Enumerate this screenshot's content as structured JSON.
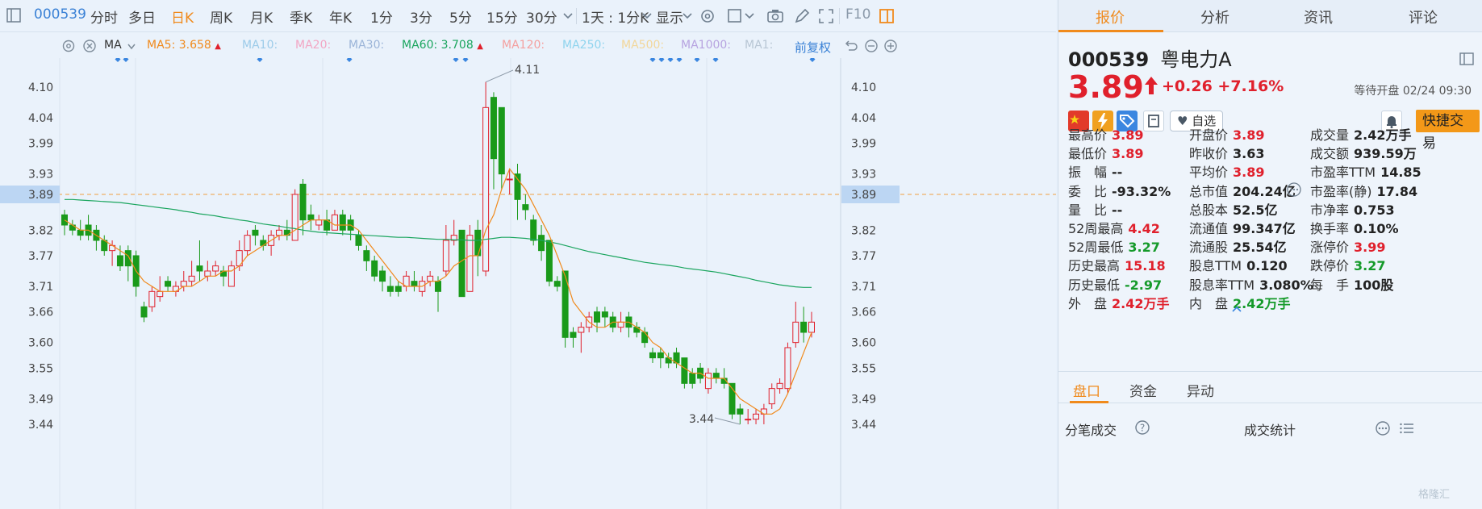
{
  "toolbar": {
    "stock_code": "000539",
    "periods": [
      "分时",
      "多日",
      "日K",
      "周K",
      "月K",
      "季K",
      "年K",
      "1分",
      "3分",
      "5分",
      "15分",
      "30分"
    ],
    "active_period": "日K",
    "interval_label": "1天 : 1分K",
    "display_label": "显示",
    "f10_label": "F10"
  },
  "ma_bar": {
    "type_label": "MA",
    "items": [
      {
        "label": "MA5:",
        "value": "3.658",
        "color": "#f08a1c",
        "arrow": true
      },
      {
        "label": "MA10:",
        "value": "",
        "color": "#9ccbe9",
        "arrow": false
      },
      {
        "label": "MA20:",
        "value": "",
        "color": "#f2a6c4",
        "arrow": false
      },
      {
        "label": "MA30:",
        "value": "",
        "color": "#9bb4d8",
        "arrow": false
      },
      {
        "label": "MA60:",
        "value": "3.708",
        "color": "#1aa55e",
        "arrow": true
      },
      {
        "label": "MA120:",
        "value": "",
        "color": "#f4a0a0",
        "arrow": false
      },
      {
        "label": "MA250:",
        "value": "",
        "color": "#8fd4ee",
        "arrow": false
      },
      {
        "label": "MA500:",
        "value": "",
        "color": "#f2d79b",
        "arrow": false
      },
      {
        "label": "MA1000:",
        "value": "",
        "color": "#b7a3e0",
        "arrow": false
      },
      {
        "label": "MA1:",
        "value": "",
        "color": "#b8c6d4",
        "arrow": false
      }
    ],
    "adjust_label": "前复权"
  },
  "chart_data": {
    "type": "candlestick",
    "y_ticks": [
      "4.10",
      "4.04",
      "3.99",
      "3.93",
      "3.89",
      "3.82",
      "3.77",
      "3.71",
      "3.66",
      "3.60",
      "3.55",
      "3.49",
      "3.44"
    ],
    "ylim": [
      3.405,
      4.16
    ],
    "current_price": 3.89,
    "max_label": "4.11",
    "min_label": "3.44",
    "up_color": "#e0202c",
    "down_color": "#1a9a1a",
    "candles": [
      [
        3.85,
        3.83,
        3.86,
        3.81
      ],
      [
        3.83,
        3.82,
        3.84,
        3.81
      ],
      [
        3.82,
        3.81,
        3.84,
        3.8
      ],
      [
        3.83,
        3.81,
        3.85,
        3.8
      ],
      [
        3.82,
        3.8,
        3.83,
        3.78
      ],
      [
        3.8,
        3.78,
        3.81,
        3.77
      ],
      [
        3.78,
        3.79,
        3.8,
        3.75
      ],
      [
        3.77,
        3.75,
        3.79,
        3.74
      ],
      [
        3.78,
        3.75,
        3.79,
        3.72
      ],
      [
        3.77,
        3.71,
        3.78,
        3.69
      ],
      [
        3.67,
        3.65,
        3.68,
        3.64
      ],
      [
        3.67,
        3.7,
        3.71,
        3.66
      ],
      [
        3.69,
        3.7,
        3.73,
        3.68
      ],
      [
        3.72,
        3.71,
        3.73,
        3.7
      ],
      [
        3.7,
        3.71,
        3.72,
        3.69
      ],
      [
        3.71,
        3.72,
        3.74,
        3.7
      ],
      [
        3.72,
        3.73,
        3.76,
        3.71
      ],
      [
        3.75,
        3.74,
        3.8,
        3.72
      ],
      [
        3.73,
        3.74,
        3.76,
        3.72
      ],
      [
        3.74,
        3.75,
        3.76,
        3.73
      ],
      [
        3.74,
        3.73,
        3.75,
        3.71
      ],
      [
        3.71,
        3.75,
        3.76,
        3.71
      ],
      [
        3.75,
        3.78,
        3.8,
        3.74
      ],
      [
        3.78,
        3.81,
        3.82,
        3.77
      ],
      [
        3.82,
        3.81,
        3.83,
        3.79
      ],
      [
        3.8,
        3.79,
        3.81,
        3.78
      ],
      [
        3.79,
        3.81,
        3.82,
        3.77
      ],
      [
        3.81,
        3.82,
        3.83,
        3.8
      ],
      [
        3.82,
        3.81,
        3.84,
        3.8
      ],
      [
        3.8,
        3.89,
        3.9,
        3.8
      ],
      [
        3.91,
        3.84,
        3.92,
        3.81
      ],
      [
        3.85,
        3.84,
        3.87,
        3.82
      ],
      [
        3.83,
        3.84,
        3.85,
        3.82
      ],
      [
        3.84,
        3.82,
        3.86,
        3.81
      ],
      [
        3.82,
        3.85,
        3.86,
        3.82
      ],
      [
        3.85,
        3.82,
        3.86,
        3.81
      ],
      [
        3.84,
        3.82,
        3.85,
        3.8
      ],
      [
        3.81,
        3.79,
        3.82,
        3.78
      ],
      [
        3.78,
        3.76,
        3.79,
        3.74
      ],
      [
        3.76,
        3.73,
        3.77,
        3.72
      ],
      [
        3.74,
        3.72,
        3.75,
        3.7
      ],
      [
        3.71,
        3.7,
        3.73,
        3.69
      ],
      [
        3.71,
        3.7,
        3.72,
        3.69
      ],
      [
        3.71,
        3.73,
        3.74,
        3.7
      ],
      [
        3.72,
        3.71,
        3.74,
        3.7
      ],
      [
        3.7,
        3.72,
        3.73,
        3.69
      ],
      [
        3.72,
        3.73,
        3.74,
        3.71
      ],
      [
        3.72,
        3.7,
        3.73,
        3.66
      ],
      [
        3.74,
        3.8,
        3.83,
        3.73
      ],
      [
        3.8,
        3.81,
        3.84,
        3.79
      ],
      [
        3.82,
        3.69,
        3.82,
        3.69
      ],
      [
        3.7,
        3.81,
        3.83,
        3.7
      ],
      [
        3.82,
        3.77,
        3.84,
        3.73
      ],
      [
        3.74,
        4.06,
        4.11,
        3.73
      ],
      [
        4.08,
        3.96,
        4.09,
        3.9
      ],
      [
        4.06,
        3.93,
        4.06,
        3.9
      ],
      [
        3.92,
        3.92,
        3.94,
        3.89
      ],
      [
        3.93,
        3.88,
        3.95,
        3.84
      ],
      [
        3.87,
        3.86,
        3.89,
        3.84
      ],
      [
        3.84,
        3.8,
        3.85,
        3.79
      ],
      [
        3.81,
        3.78,
        3.83,
        3.76
      ],
      [
        3.8,
        3.72,
        3.8,
        3.71
      ],
      [
        3.72,
        3.71,
        3.73,
        3.7
      ],
      [
        3.74,
        3.61,
        3.74,
        3.59
      ],
      [
        3.62,
        3.61,
        3.63,
        3.59
      ],
      [
        3.62,
        3.63,
        3.64,
        3.58
      ],
      [
        3.63,
        3.65,
        3.66,
        3.62
      ],
      [
        3.66,
        3.64,
        3.67,
        3.62
      ],
      [
        3.66,
        3.65,
        3.67,
        3.63
      ],
      [
        3.65,
        3.63,
        3.66,
        3.62
      ],
      [
        3.63,
        3.64,
        3.66,
        3.62
      ],
      [
        3.65,
        3.63,
        3.66,
        3.61
      ],
      [
        3.63,
        3.62,
        3.64,
        3.61
      ],
      [
        3.62,
        3.6,
        3.63,
        3.59
      ],
      [
        3.58,
        3.57,
        3.59,
        3.56
      ],
      [
        3.58,
        3.57,
        3.59,
        3.55
      ],
      [
        3.57,
        3.56,
        3.58,
        3.55
      ],
      [
        3.58,
        3.56,
        3.59,
        3.55
      ],
      [
        3.57,
        3.52,
        3.57,
        3.51
      ],
      [
        3.54,
        3.52,
        3.55,
        3.51
      ],
      [
        3.55,
        3.53,
        3.56,
        3.52
      ],
      [
        3.51,
        3.54,
        3.55,
        3.5
      ],
      [
        3.54,
        3.53,
        3.55,
        3.52
      ],
      [
        3.53,
        3.52,
        3.55,
        3.51
      ],
      [
        3.52,
        3.46,
        3.52,
        3.45
      ],
      [
        3.47,
        3.46,
        3.48,
        3.44
      ],
      [
        3.45,
        3.45,
        3.47,
        3.44
      ],
      [
        3.45,
        3.46,
        3.47,
        3.44
      ],
      [
        3.46,
        3.47,
        3.48,
        3.44
      ],
      [
        3.48,
        3.51,
        3.52,
        3.47
      ],
      [
        3.51,
        3.52,
        3.53,
        3.5
      ],
      [
        3.51,
        3.59,
        3.6,
        3.5
      ],
      [
        3.6,
        3.64,
        3.68,
        3.59
      ],
      [
        3.64,
        3.62,
        3.67,
        3.6
      ],
      [
        3.62,
        3.64,
        3.66,
        3.61
      ]
    ],
    "ma5": [
      3.84,
      3.83,
      3.82,
      3.82,
      3.81,
      3.8,
      3.79,
      3.78,
      3.77,
      3.74,
      3.72,
      3.71,
      3.7,
      3.7,
      3.7,
      3.71,
      3.71,
      3.72,
      3.73,
      3.73,
      3.74,
      3.74,
      3.75,
      3.77,
      3.78,
      3.79,
      3.8,
      3.81,
      3.81,
      3.82,
      3.83,
      3.84,
      3.84,
      3.84,
      3.83,
      3.83,
      3.83,
      3.82,
      3.8,
      3.78,
      3.76,
      3.74,
      3.72,
      3.71,
      3.71,
      3.71,
      3.72,
      3.72,
      3.73,
      3.75,
      3.76,
      3.77,
      3.77,
      3.82,
      3.85,
      3.9,
      3.94,
      3.92,
      3.9,
      3.87,
      3.84,
      3.81,
      3.77,
      3.73,
      3.68,
      3.66,
      3.64,
      3.63,
      3.63,
      3.64,
      3.64,
      3.64,
      3.63,
      3.62,
      3.6,
      3.59,
      3.57,
      3.56,
      3.55,
      3.54,
      3.54,
      3.53,
      3.53,
      3.53,
      3.51,
      3.49,
      3.48,
      3.47,
      3.46,
      3.46,
      3.47,
      3.5,
      3.54,
      3.58,
      3.62
    ],
    "ma60": [
      3.88,
      3.88,
      3.879,
      3.878,
      3.877,
      3.876,
      3.875,
      3.874,
      3.872,
      3.87,
      3.868,
      3.866,
      3.864,
      3.862,
      3.86,
      3.857,
      3.855,
      3.852,
      3.85,
      3.848,
      3.845,
      3.843,
      3.84,
      3.838,
      3.835,
      3.832,
      3.83,
      3.828,
      3.825,
      3.823,
      3.82,
      3.818,
      3.816,
      3.815,
      3.814,
      3.813,
      3.812,
      3.811,
      3.81,
      3.809,
      3.808,
      3.807,
      3.806,
      3.806,
      3.805,
      3.804,
      3.803,
      3.802,
      3.802,
      3.801,
      3.801,
      3.8,
      3.8,
      3.802,
      3.804,
      3.806,
      3.806,
      3.805,
      3.804,
      3.802,
      3.8,
      3.797,
      3.794,
      3.79,
      3.786,
      3.782,
      3.778,
      3.775,
      3.772,
      3.769,
      3.766,
      3.763,
      3.76,
      3.757,
      3.755,
      3.753,
      3.751,
      3.749,
      3.746,
      3.744,
      3.742,
      3.74,
      3.738,
      3.735,
      3.732,
      3.729,
      3.726,
      3.722,
      3.719,
      3.716,
      3.713,
      3.711,
      3.709,
      3.708,
      3.708
    ]
  },
  "quote": {
    "tabs": [
      "报价",
      "分析",
      "资讯",
      "评论"
    ],
    "code": "000539",
    "name": "粤电力A",
    "price": "3.89",
    "change": "+0.26  +7.16%",
    "status": "等待开盘 02/24 09:30",
    "watch_label": "自选",
    "quick_trade": "快捷交易",
    "stats": [
      [
        {
          "label": "最高价",
          "value": "3.89",
          "color": "red"
        },
        {
          "label": "开盘价",
          "value": "3.89",
          "color": "red"
        },
        {
          "label": "成交量",
          "value": "2.42万手",
          "color": "dark"
        }
      ],
      [
        {
          "label": "最低价",
          "value": "3.89",
          "color": "red"
        },
        {
          "label": "昨收价",
          "value": "3.63",
          "color": "dark"
        },
        {
          "label": "成交额",
          "value": "939.59万",
          "color": "dark"
        }
      ],
      [
        {
          "label": "振　幅",
          "value": "--",
          "color": "dark"
        },
        {
          "label": "平均价",
          "value": "3.89",
          "color": "red"
        },
        {
          "label": "市盈率TTM",
          "value": "14.85",
          "color": "dark"
        }
      ],
      [
        {
          "label": "委　比",
          "value": "-93.32%",
          "color": "dark"
        },
        {
          "label": "总市值",
          "value": "204.24亿",
          "color": "dark"
        },
        {
          "label": "市盈率(静)",
          "value": "17.84",
          "color": "dark"
        }
      ],
      [
        {
          "label": "量　比",
          "value": "--",
          "color": "dark"
        },
        {
          "label": "总股本",
          "value": "52.5亿",
          "color": "dark"
        },
        {
          "label": "市净率",
          "value": "0.753",
          "color": "dark"
        }
      ],
      [
        {
          "label": "52周最高",
          "value": "4.42",
          "color": "red"
        },
        {
          "label": "流通值",
          "value": "99.347亿",
          "color": "dark"
        },
        {
          "label": "换手率",
          "value": "0.10%",
          "color": "dark"
        }
      ],
      [
        {
          "label": "52周最低",
          "value": "3.27",
          "color": "green"
        },
        {
          "label": "流通股",
          "value": "25.54亿",
          "color": "dark"
        },
        {
          "label": "涨停价",
          "value": "3.99",
          "color": "red"
        }
      ],
      [
        {
          "label": "历史最高",
          "value": "15.18",
          "color": "red"
        },
        {
          "label": "股息TTM",
          "value": "0.120",
          "color": "dark"
        },
        {
          "label": "跌停价",
          "value": "3.27",
          "color": "green"
        }
      ],
      [
        {
          "label": "历史最低",
          "value": "-2.97",
          "color": "green"
        },
        {
          "label": "股息率TTM",
          "value": "3.080%",
          "color": "dark"
        },
        {
          "label": "每　手",
          "value": "100股",
          "color": "dark"
        }
      ],
      [
        {
          "label": "外　盘",
          "value": "2.42万手",
          "color": "red"
        },
        {
          "label": "内　盘",
          "value": "2.42万手",
          "color": "green"
        },
        {
          "label": "",
          "value": "",
          "color": "dark"
        }
      ]
    ],
    "sub_tabs": [
      "盘口",
      "资金",
      "异动"
    ],
    "tick_label": "分笔成交",
    "stats_label": "成交统计"
  },
  "watermark": "格隆汇"
}
